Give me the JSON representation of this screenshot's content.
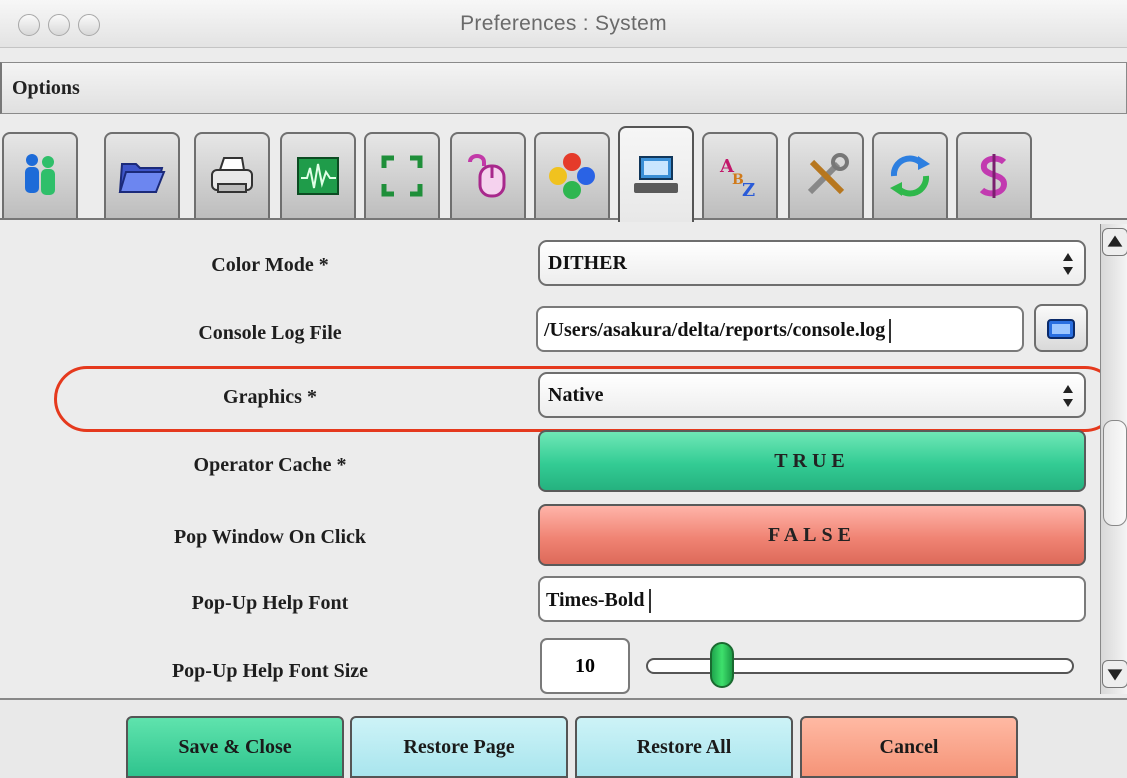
{
  "window": {
    "title": "Preferences : System"
  },
  "options": {
    "label": "Options"
  },
  "tabs": [
    {
      "icon": "people-icon"
    },
    {
      "icon": "folder-icon"
    },
    {
      "icon": "printer-icon"
    },
    {
      "icon": "waveform-icon"
    },
    {
      "icon": "fullscreen-icon"
    },
    {
      "icon": "mouse-icon"
    },
    {
      "icon": "color-dots-icon"
    },
    {
      "icon": "computer-icon",
      "active": true
    },
    {
      "icon": "font-letters-icon"
    },
    {
      "icon": "tools-icon"
    },
    {
      "icon": "refresh-arrows-icon"
    },
    {
      "icon": "dollar-sign-icon"
    }
  ],
  "prefs": {
    "color_mode": {
      "label": "Color Mode *",
      "value": "DITHER"
    },
    "console_log_file": {
      "label": "Console Log File",
      "value": "/Users/asakura/delta/reports/console.log"
    },
    "graphics": {
      "label": "Graphics *",
      "value": "Native"
    },
    "operator_cache": {
      "label": "Operator Cache *",
      "value": "TRUE"
    },
    "pop_window_on_click": {
      "label": "Pop Window On Click",
      "value": "FALSE"
    },
    "popup_help_font": {
      "label": "Pop-Up Help Font",
      "value": "Times-Bold"
    },
    "popup_help_font_size": {
      "label": "Pop-Up Help Font Size",
      "value": "10"
    }
  },
  "buttons": {
    "save_close": "Save & Close",
    "restore_page": "Restore Page",
    "restore_all": "Restore All",
    "cancel": "Cancel"
  },
  "colors": {
    "true_green": "#33cc94",
    "false_red": "#f08474",
    "highlight": "#e5391d"
  }
}
